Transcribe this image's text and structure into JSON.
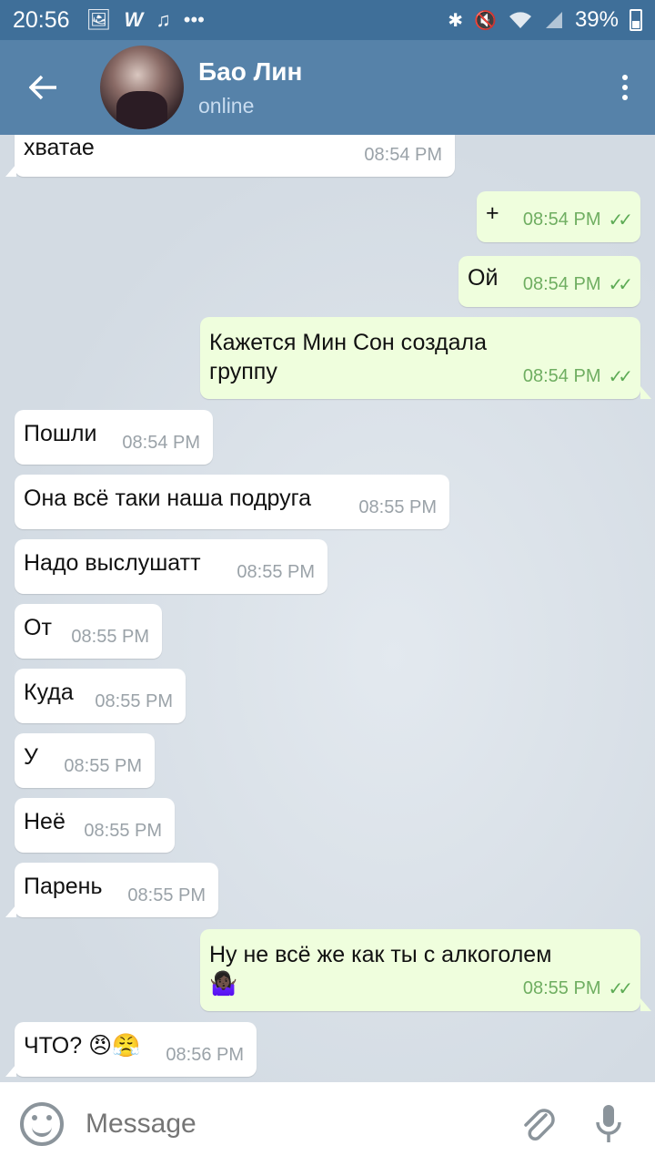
{
  "status_bar": {
    "time": "20:56",
    "battery": "39%",
    "icons": [
      "gallery-icon",
      "w-icon",
      "music-icon",
      "more-icon",
      "bluetooth-icon",
      "mute-icon",
      "wifi-icon",
      "signal-icon",
      "battery-icon"
    ],
    "more": "•••"
  },
  "header": {
    "name": "Бао Лин",
    "status": "online"
  },
  "messages": [
    {
      "dir": "in",
      "text": "хватае",
      "time": "08:54 PM"
    },
    {
      "dir": "out",
      "text": "+",
      "time": "08:54 PM"
    },
    {
      "dir": "out",
      "text": "Ой",
      "time": "08:54 PM"
    },
    {
      "dir": "out",
      "text_line1": "Кажется Мин Сон создала",
      "text_line2": "группу",
      "time": "08:54 PM"
    },
    {
      "dir": "in",
      "text": "Пошли",
      "time": "08:54 PM"
    },
    {
      "dir": "in",
      "text": "Она всё таки наша подруга",
      "time": "08:55 PM"
    },
    {
      "dir": "in",
      "text": "Надо выслушатт",
      "time": "08:55 PM"
    },
    {
      "dir": "in",
      "text": "От",
      "time": "08:55 PM"
    },
    {
      "dir": "in",
      "text": "Куда",
      "time": "08:55 PM"
    },
    {
      "dir": "in",
      "text": "У",
      "time": "08:55 PM"
    },
    {
      "dir": "in",
      "text": "Неё",
      "time": "08:55 PM"
    },
    {
      "dir": "in",
      "text": "Парень",
      "time": "08:55 PM"
    },
    {
      "dir": "out",
      "text_line1": "Ну не всё же как ты с алкоголем",
      "text_line2": "🤷🏿‍♀️",
      "time": "08:55 PM"
    },
    {
      "dir": "in",
      "text": "ЧТО? 😠😤",
      "time": "08:56 PM"
    }
  ],
  "input": {
    "placeholder": "Message"
  },
  "colors": {
    "header": "#5682a9",
    "status_bar": "#3f6f99",
    "outgoing_bubble": "#effedd",
    "check": "#5dab55"
  }
}
